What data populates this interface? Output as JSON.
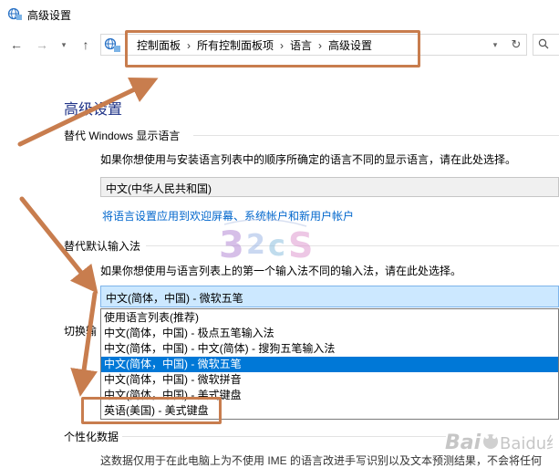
{
  "window": {
    "title": "高级设置"
  },
  "breadcrumb": {
    "items": [
      "控制面板",
      "所有控制面板项",
      "语言",
      "高级设置"
    ],
    "separator": "›"
  },
  "main": {
    "heading": "高级设置",
    "display_language": {
      "label": "替代 Windows 显示语言",
      "description": "如果你想使用与安装语言列表中的顺序所确定的语言不同的显示语言，请在此处选择。",
      "selected": "中文(中华人民共和国)",
      "link": "将语言设置应用到欢迎屏幕、系统帐户和新用户帐户"
    },
    "input_method": {
      "label": "替代默认输入法",
      "description": "如果你想使用与语言列表上的第一个输入法不同的输入法，请在此处选择。",
      "selected": "中文(简体，中国) - 微软五笔",
      "options": [
        "使用语言列表(推荐)",
        "中文(简体，中国) - 极点五笔输入法",
        "中文(简体，中国) - 中文(简体) - 搜狗五笔输入法",
        "中文(简体，中国) - 微软五笔",
        "中文(简体，中国) - 微软拼音",
        "中文(简体，中国) - 美式键盘",
        "英语(美国) - 美式键盘"
      ],
      "highlighted_index": 3
    },
    "switch_label_partial": "切换输",
    "personalization": {
      "label": "个性化数据",
      "text_partial": "这数据仅用于在此电脑上为不使用 IME 的语言改进手写识别以及文本预测结果，不会将任何"
    }
  },
  "watermark": {
    "site": "Baidu经验"
  },
  "colors": {
    "heading": "#1e3287",
    "link": "#0066cc",
    "selection": "#0078d7",
    "annotation": "#c87d4e"
  }
}
